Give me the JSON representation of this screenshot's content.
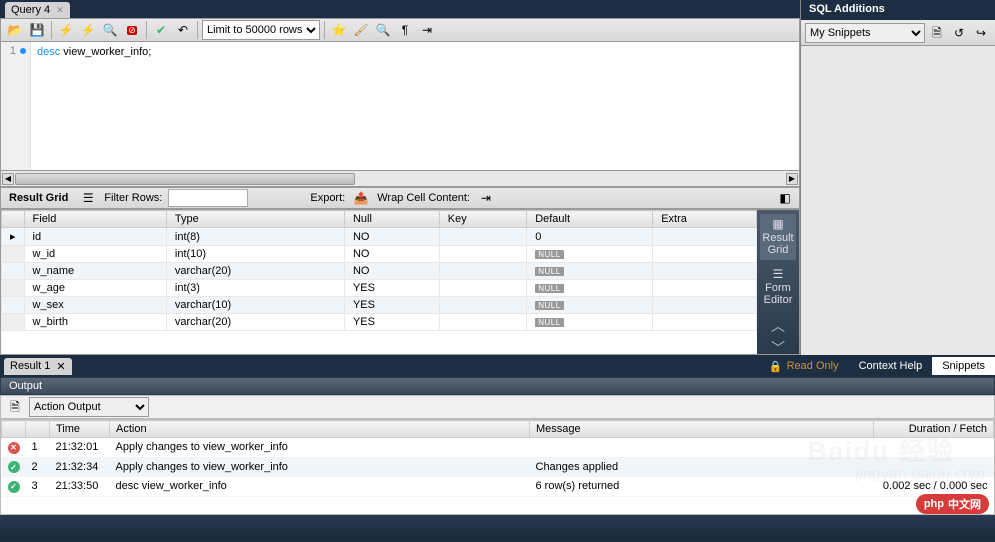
{
  "queryTab": {
    "label": "Query 4"
  },
  "toolbar": {
    "limit": "Limit to 50000 rows"
  },
  "editor": {
    "line1_num": "1",
    "line1_kw": "desc",
    "line1_rest": " view_worker_info;"
  },
  "resultToolbar": {
    "gridLabel": "Result Grid",
    "filterLabel": "Filter Rows:",
    "exportLabel": "Export:",
    "wrapLabel": "Wrap Cell Content:"
  },
  "resultColumns": [
    "Field",
    "Type",
    "Null",
    "Key",
    "Default",
    "Extra"
  ],
  "resultRows": [
    {
      "field": "id",
      "type": "int(8)",
      "null": "NO",
      "key": "",
      "default": "0",
      "extra": "",
      "isNull": false
    },
    {
      "field": "w_id",
      "type": "int(10)",
      "null": "NO",
      "key": "",
      "default": "NULL",
      "extra": "",
      "isNull": true
    },
    {
      "field": "w_name",
      "type": "varchar(20)",
      "null": "NO",
      "key": "",
      "default": "NULL",
      "extra": "",
      "isNull": true
    },
    {
      "field": "w_age",
      "type": "int(3)",
      "null": "YES",
      "key": "",
      "default": "NULL",
      "extra": "",
      "isNull": true
    },
    {
      "field": "w_sex",
      "type": "varchar(10)",
      "null": "YES",
      "key": "",
      "default": "NULL",
      "extra": "",
      "isNull": true
    },
    {
      "field": "w_birth",
      "type": "varchar(20)",
      "null": "YES",
      "key": "",
      "default": "NULL",
      "extra": "",
      "isNull": true
    }
  ],
  "sideBar": {
    "grid": "Result\nGrid",
    "form": "Form\nEditor"
  },
  "sqlAdd": {
    "title": "SQL Additions",
    "snippets": "My Snippets"
  },
  "resultTab": {
    "label": "Result 1",
    "readOnly": "Read Only",
    "ctxHelp": "Context Help",
    "snippets": "Snippets"
  },
  "output": {
    "title": "Output",
    "mode": "Action Output",
    "columns": [
      "",
      "",
      "Time",
      "Action",
      "Message",
      "Duration / Fetch"
    ],
    "rows": [
      {
        "status": "err",
        "n": "1",
        "time": "21:32:01",
        "action": "Apply changes to view_worker_info",
        "message": "",
        "duration": ""
      },
      {
        "status": "ok",
        "n": "2",
        "time": "21:32:34",
        "action": "Apply changes to view_worker_info",
        "message": "Changes applied",
        "duration": ""
      },
      {
        "status": "ok",
        "n": "3",
        "time": "21:33:50",
        "action": "desc view_worker_info",
        "message": "6 row(s) returned",
        "duration": "0.002 sec / 0.000 sec"
      }
    ]
  },
  "watermark": {
    "baidu": "Baidu 经验",
    "url": "jingyan.baidu.com",
    "logo": "php 中文网"
  }
}
